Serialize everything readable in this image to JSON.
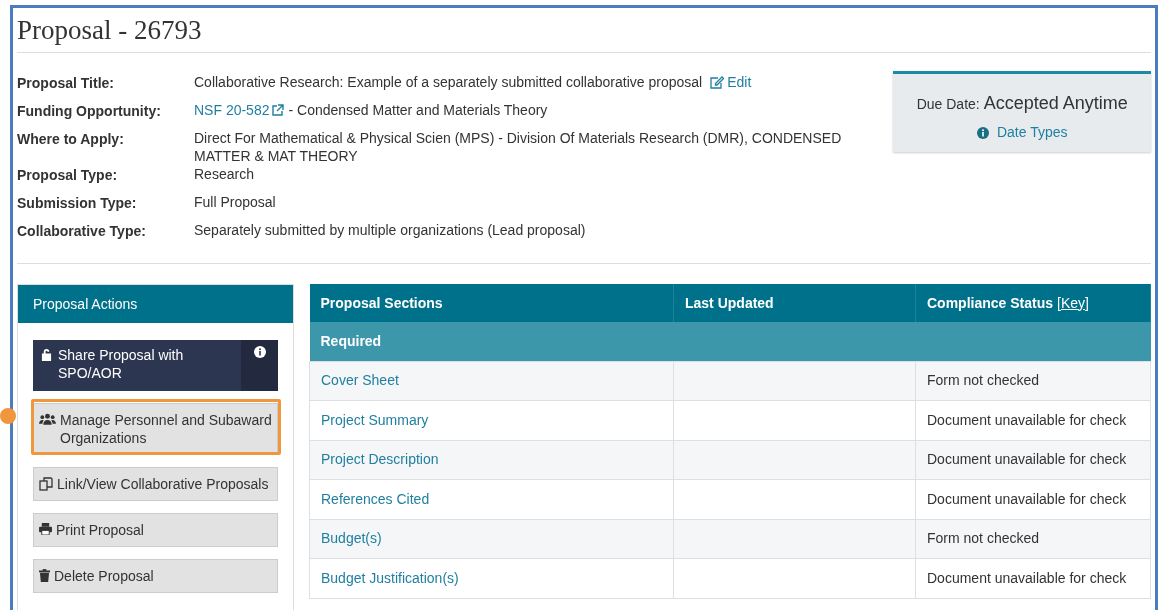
{
  "page_title": "Proposal - 26793",
  "details": [
    {
      "label": "Proposal Title:",
      "value": "Collaborative Research: Example of a separately submitted collaborative proposal",
      "link": "Edit"
    },
    {
      "label": "Funding Opportunity:",
      "prefix_link": "NSF 20-582",
      "value": "- Condensed Matter and Materials Theory"
    },
    {
      "label": "Where to Apply:",
      "value": "Direct For Mathematical & Physical Scien (MPS) - Division Of Materials Research (DMR), CONDENSED MATTER & MAT THEORY"
    },
    {
      "label": "Proposal Type:",
      "value": "Research"
    },
    {
      "label": "Submission Type:",
      "value": "Full Proposal"
    },
    {
      "label": "Collaborative Type:",
      "value": "Separately submitted by multiple organizations (Lead proposal)"
    }
  ],
  "due_date": {
    "label": "Due Date:",
    "value": "Accepted Anytime",
    "link": "Date Types"
  },
  "actions_panel": {
    "title": "Proposal Actions",
    "actions": [
      {
        "label": "Share Proposal with SPO/AOR",
        "kind": "primary",
        "highlighted": false
      },
      {
        "label": "Manage Personnel and Subaward Organizations",
        "kind": "default",
        "highlighted": true
      },
      {
        "label": "Link/View Collaborative Proposals",
        "kind": "default",
        "highlighted": false
      },
      {
        "label": "Print Proposal",
        "kind": "default",
        "highlighted": false
      },
      {
        "label": "Delete Proposal",
        "kind": "default",
        "highlighted": false
      }
    ]
  },
  "sections_table": {
    "columns": [
      "Proposal Sections",
      "Last Updated",
      "Compliance Status"
    ],
    "key_link": "[Key]",
    "group": "Required",
    "rows": [
      {
        "section": "Cover Sheet",
        "status": "Form not checked"
      },
      {
        "section": "Project Summary",
        "status": "Document unavailable for check"
      },
      {
        "section": "Project Description",
        "status": "Document unavailable for check"
      },
      {
        "section": "References Cited",
        "status": "Document unavailable for check"
      },
      {
        "section": "Budget(s)",
        "status": "Form not checked"
      },
      {
        "section": "Budget Justification(s)",
        "status": "Document unavailable for check"
      }
    ]
  }
}
